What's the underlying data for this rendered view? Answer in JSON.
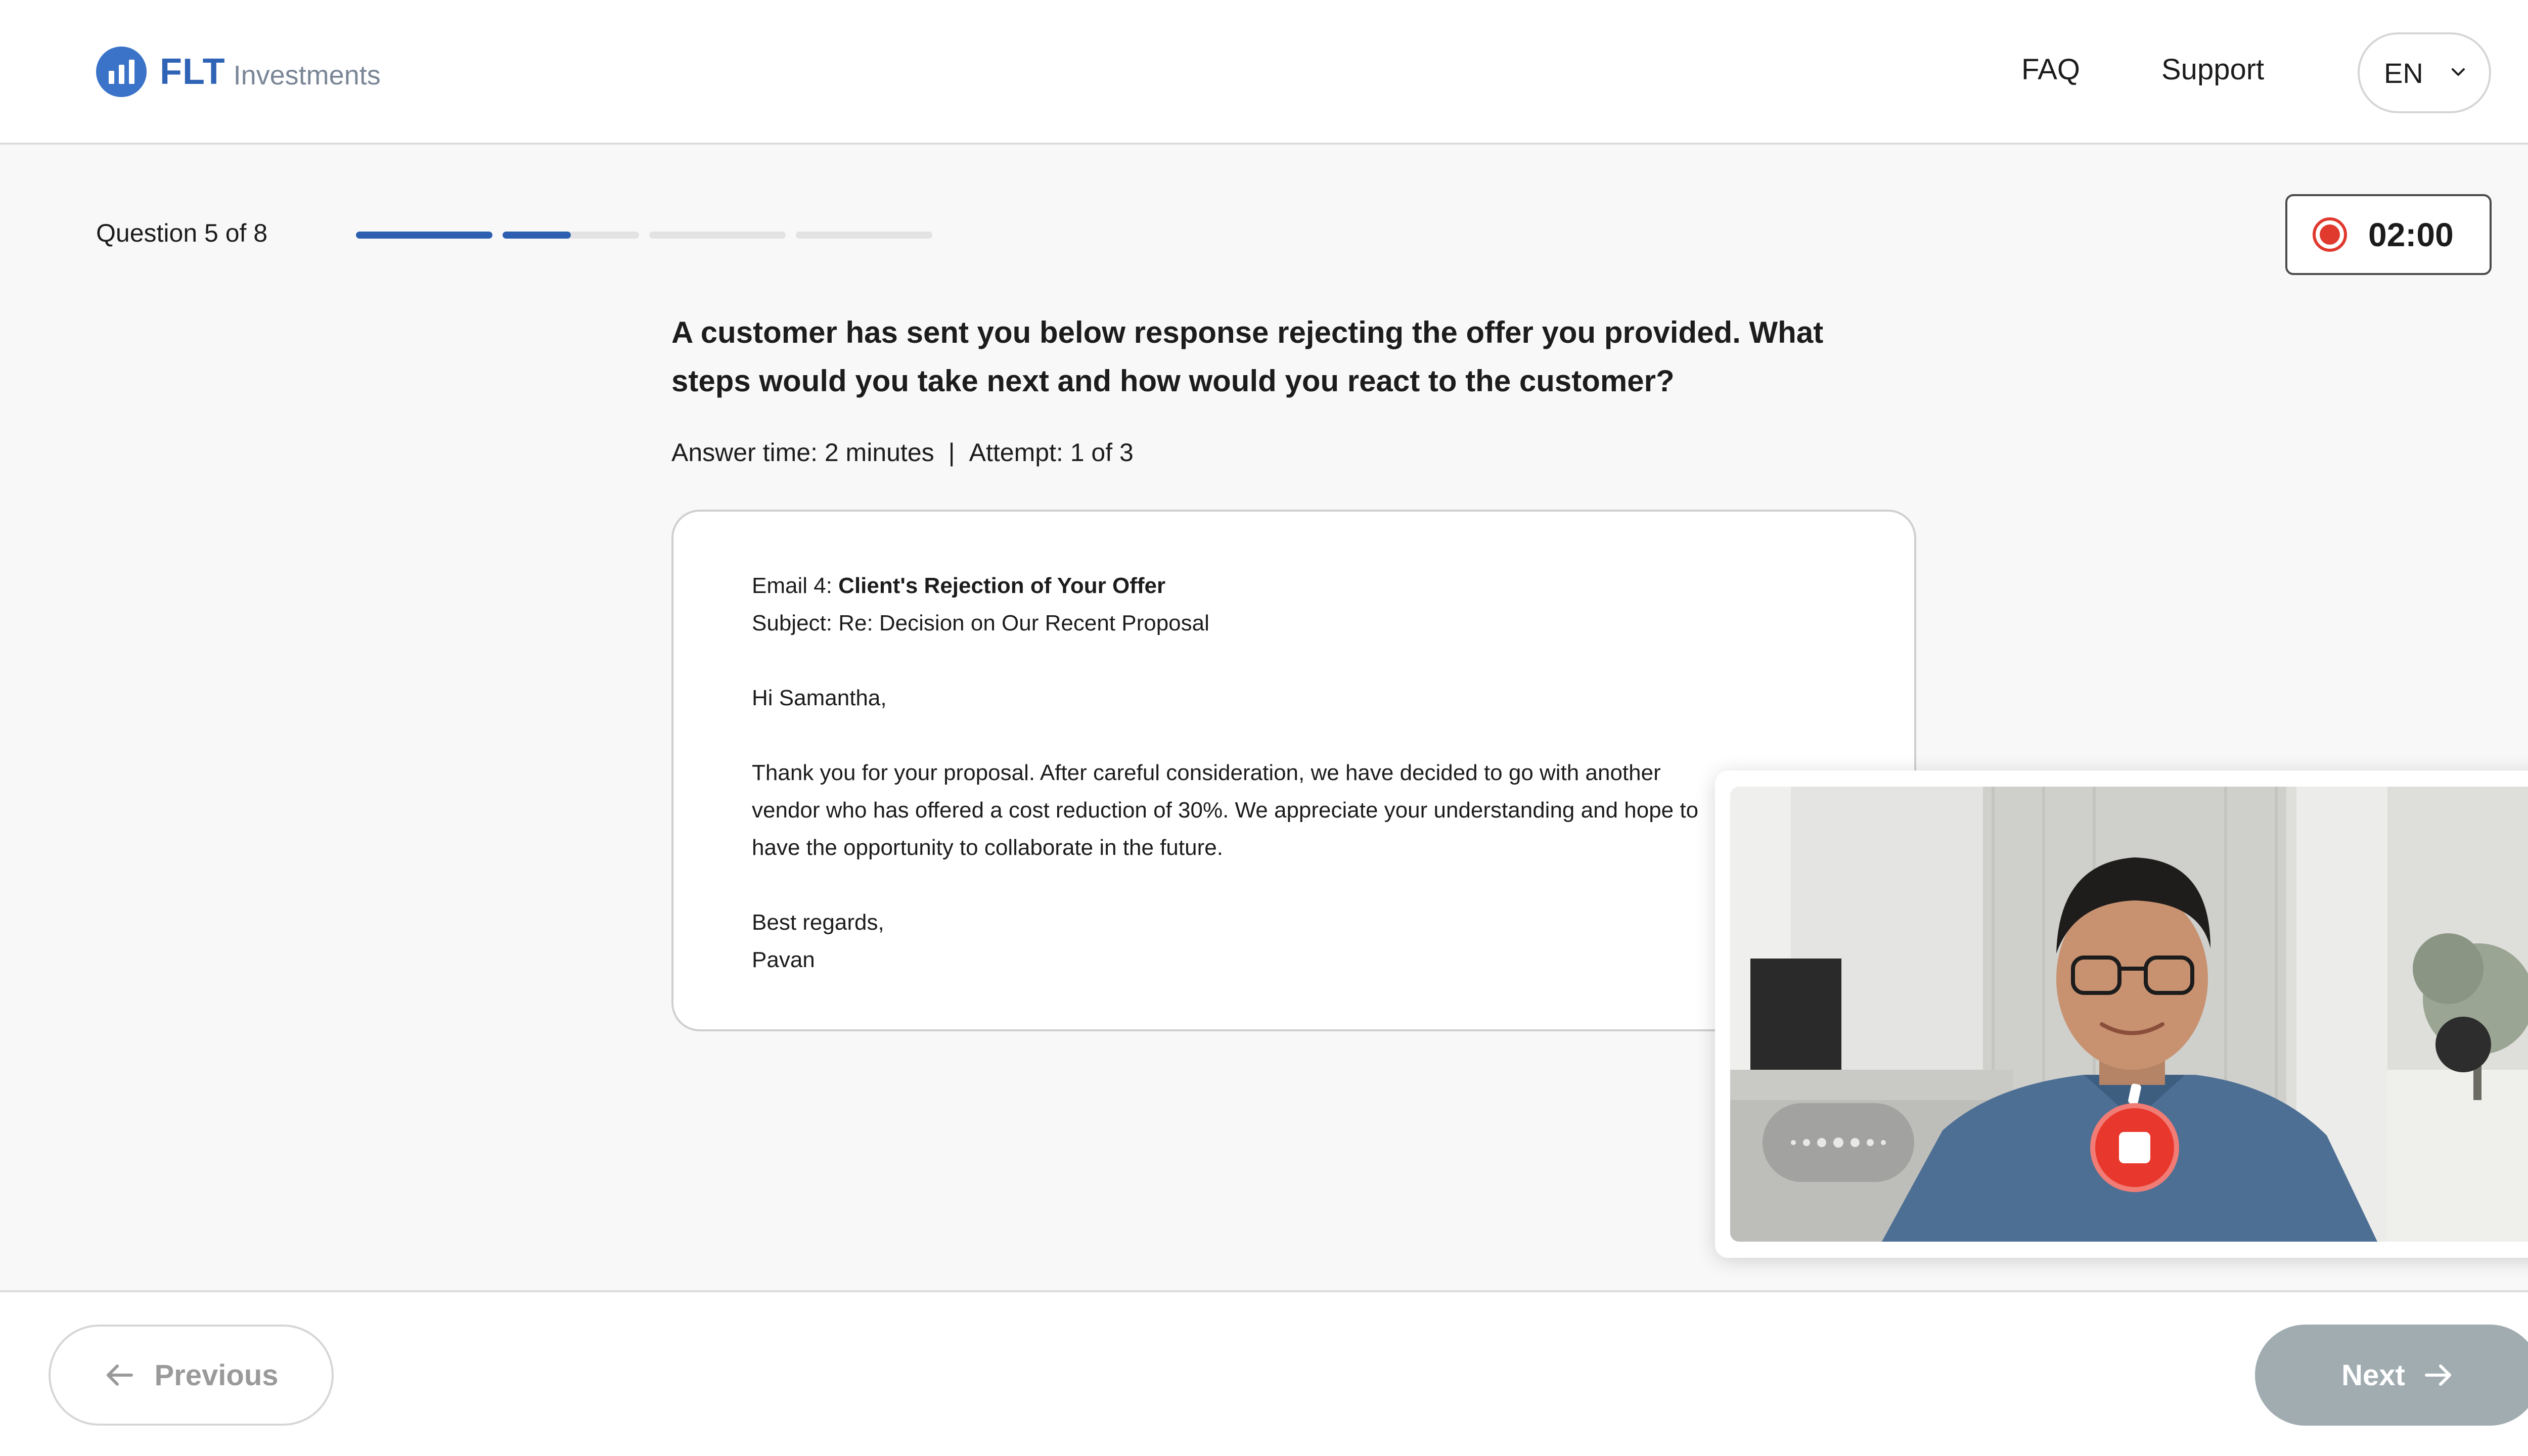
{
  "header": {
    "brand": "FLT",
    "brand_sub": "Investments",
    "nav": {
      "faq": "FAQ",
      "support": "Support"
    },
    "language": "EN"
  },
  "progress": {
    "question_label": "Question 5 of 8",
    "segments": [
      1,
      0.5,
      0,
      0
    ]
  },
  "timer": {
    "value": "02:00",
    "recording": true
  },
  "question": {
    "text": "A customer has sent you below response rejecting the offer you provided. What steps would you take next and how would you react to the customer?",
    "answer_time": "Answer time: 2 minutes",
    "separator": "|",
    "attempt": "Attempt: 1 of 3"
  },
  "email": {
    "label_prefix": "Email 4: ",
    "label_title": "Client's Rejection of Your Offer",
    "subject": "Subject: Re: Decision on Our Recent Proposal",
    "greeting": "Hi Samantha,",
    "body_lines": [
      "Thank you for your proposal. After careful consideration, we have decided to go with another",
      "vendor who has offered a cost reduction of 30%. We appreciate your understanding and hope to",
      "have the opportunity to collaborate in the future."
    ],
    "closing": "Best regards,",
    "signature": "Pavan"
  },
  "video": {
    "mic_icon": "audio-level-icon",
    "stop_icon": "stop-recording-icon"
  },
  "footer": {
    "previous_label": "Previous",
    "next_label": "Next"
  },
  "colors": {
    "accent": "#2c5fb0",
    "record": "#e03a2f",
    "next_disabled": "#a1acb1"
  }
}
